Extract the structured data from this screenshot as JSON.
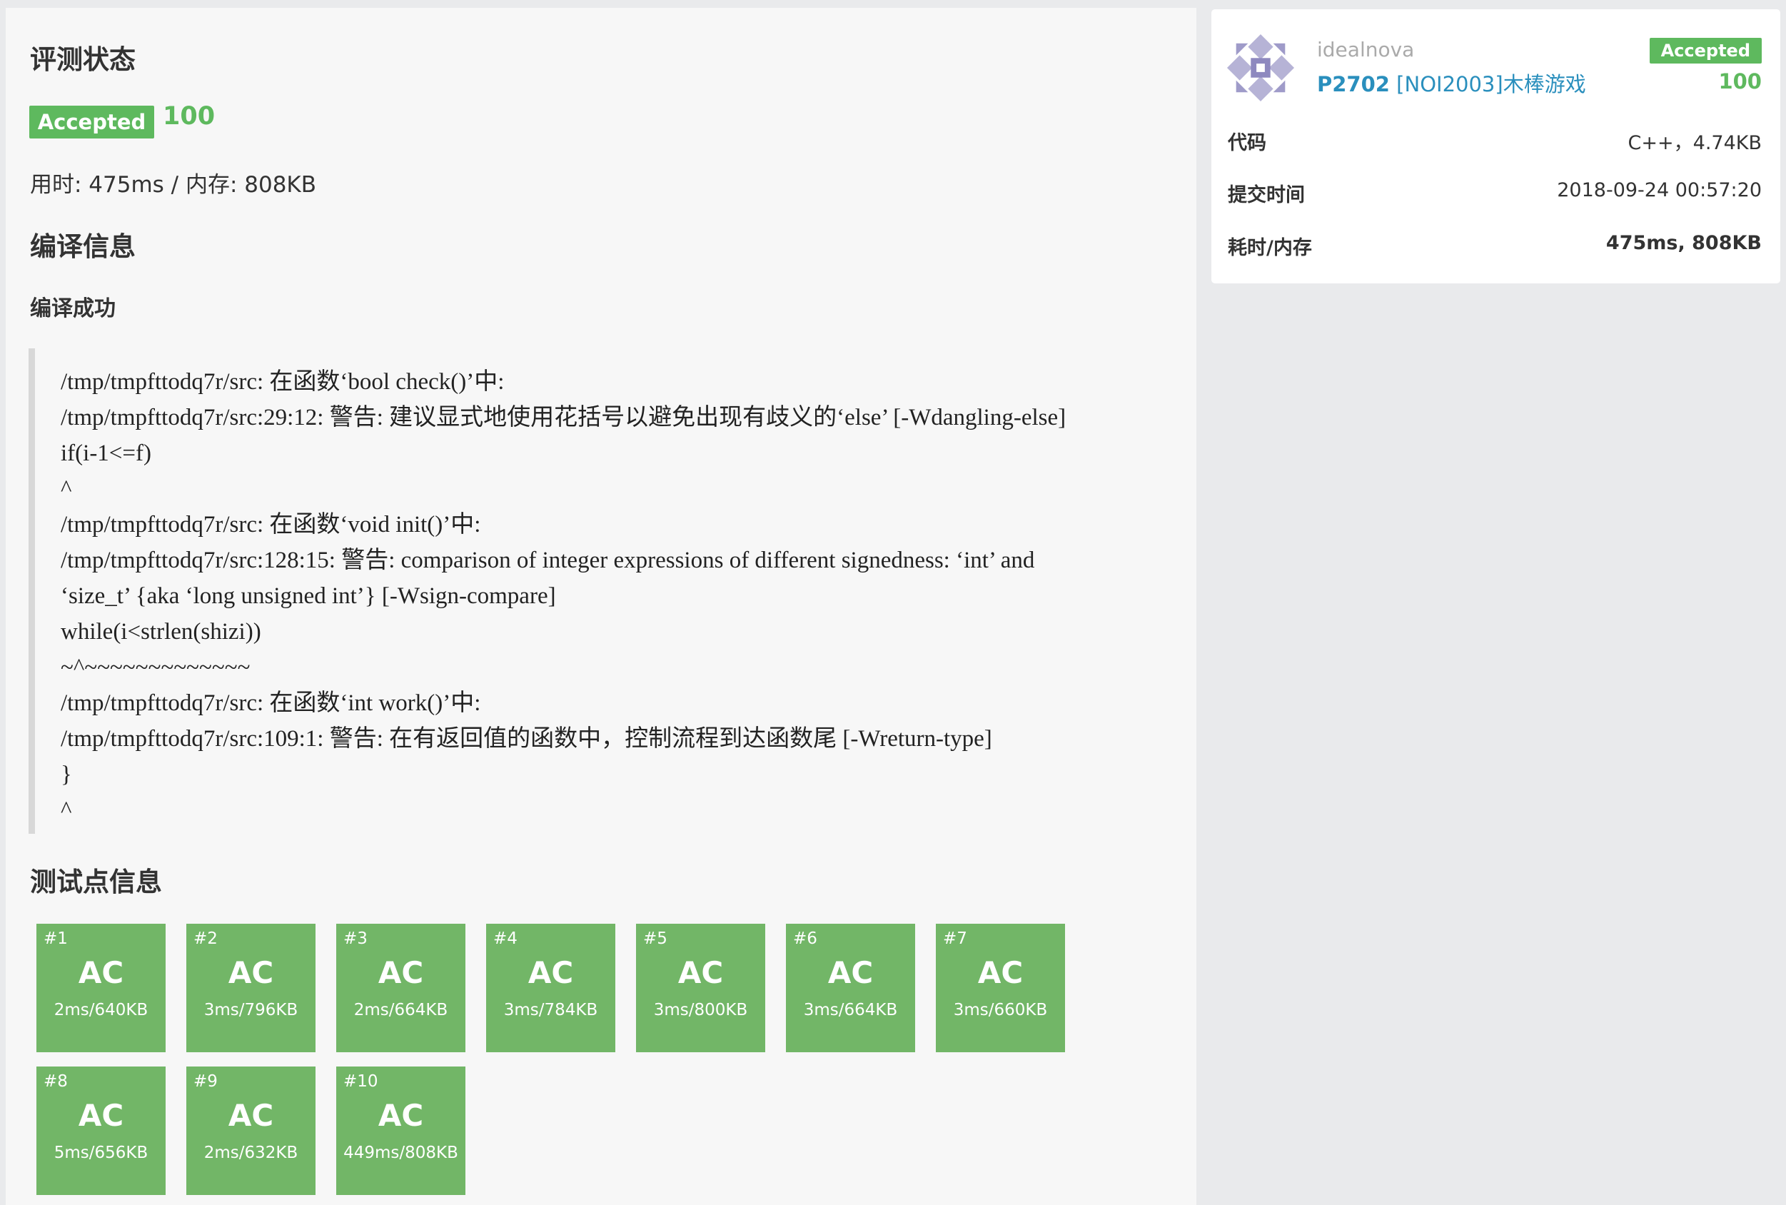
{
  "status": {
    "heading": "评测状态",
    "badge": "Accepted",
    "score": "100",
    "usage": "用时: 475ms / 内存: 808KB"
  },
  "compile": {
    "heading": "编译信息",
    "result": "编译成功",
    "log": [
      "/tmp/tmpfttodq7r/src: 在函数‘bool check()’中:",
      "/tmp/tmpfttodq7r/src:29:12: 警告:  建议显式地使用花括号以避免出现有歧义的‘else’ [-Wdangling-else]",
      "if(i-1<=f)",
      "^",
      "/tmp/tmpfttodq7r/src: 在函数‘void init()’中:",
      "/tmp/tmpfttodq7r/src:128:15: 警告:  comparison of integer expressions of different signedness: ‘int’ and",
      "‘size_t’ {aka ‘long unsigned int’} [-Wsign-compare]",
      "while(i<strlen(shizi))",
      "~^~~~~~~~~~~~~~",
      "/tmp/tmpfttodq7r/src: 在函数‘int work()’中:",
      "/tmp/tmpfttodq7r/src:109:1: 警告:  在有返回值的函数中，控制流程到达函数尾 [-Wreturn-type]",
      "}",
      "^"
    ]
  },
  "testcases": {
    "heading": "测试点信息",
    "items": [
      {
        "num": "#1",
        "result": "AC",
        "meta": "2ms/640KB"
      },
      {
        "num": "#2",
        "result": "AC",
        "meta": "3ms/796KB"
      },
      {
        "num": "#3",
        "result": "AC",
        "meta": "2ms/664KB"
      },
      {
        "num": "#4",
        "result": "AC",
        "meta": "3ms/784KB"
      },
      {
        "num": "#5",
        "result": "AC",
        "meta": "3ms/800KB"
      },
      {
        "num": "#6",
        "result": "AC",
        "meta": "3ms/664KB"
      },
      {
        "num": "#7",
        "result": "AC",
        "meta": "3ms/660KB"
      },
      {
        "num": "#8",
        "result": "AC",
        "meta": "5ms/656KB"
      },
      {
        "num": "#9",
        "result": "AC",
        "meta": "2ms/632KB"
      },
      {
        "num": "#10",
        "result": "AC",
        "meta": "449ms/808KB"
      }
    ]
  },
  "sidebar": {
    "username": "idealnova",
    "problem_id": "P2702",
    "problem_title": " [NOI2003]木棒游戏",
    "badge": "Accepted",
    "score": "100",
    "code_label": "代码",
    "code_value": "C++，4.74KB",
    "time_label": "提交时间",
    "time_value": "2018-09-24 00:57:20",
    "usage_label": "耗时/内存",
    "usage_value": "475ms, 808KB"
  },
  "colors": {
    "accent_green": "#5eb95e",
    "testcase_green": "#72b667",
    "link_blue": "#2a8fbd"
  }
}
